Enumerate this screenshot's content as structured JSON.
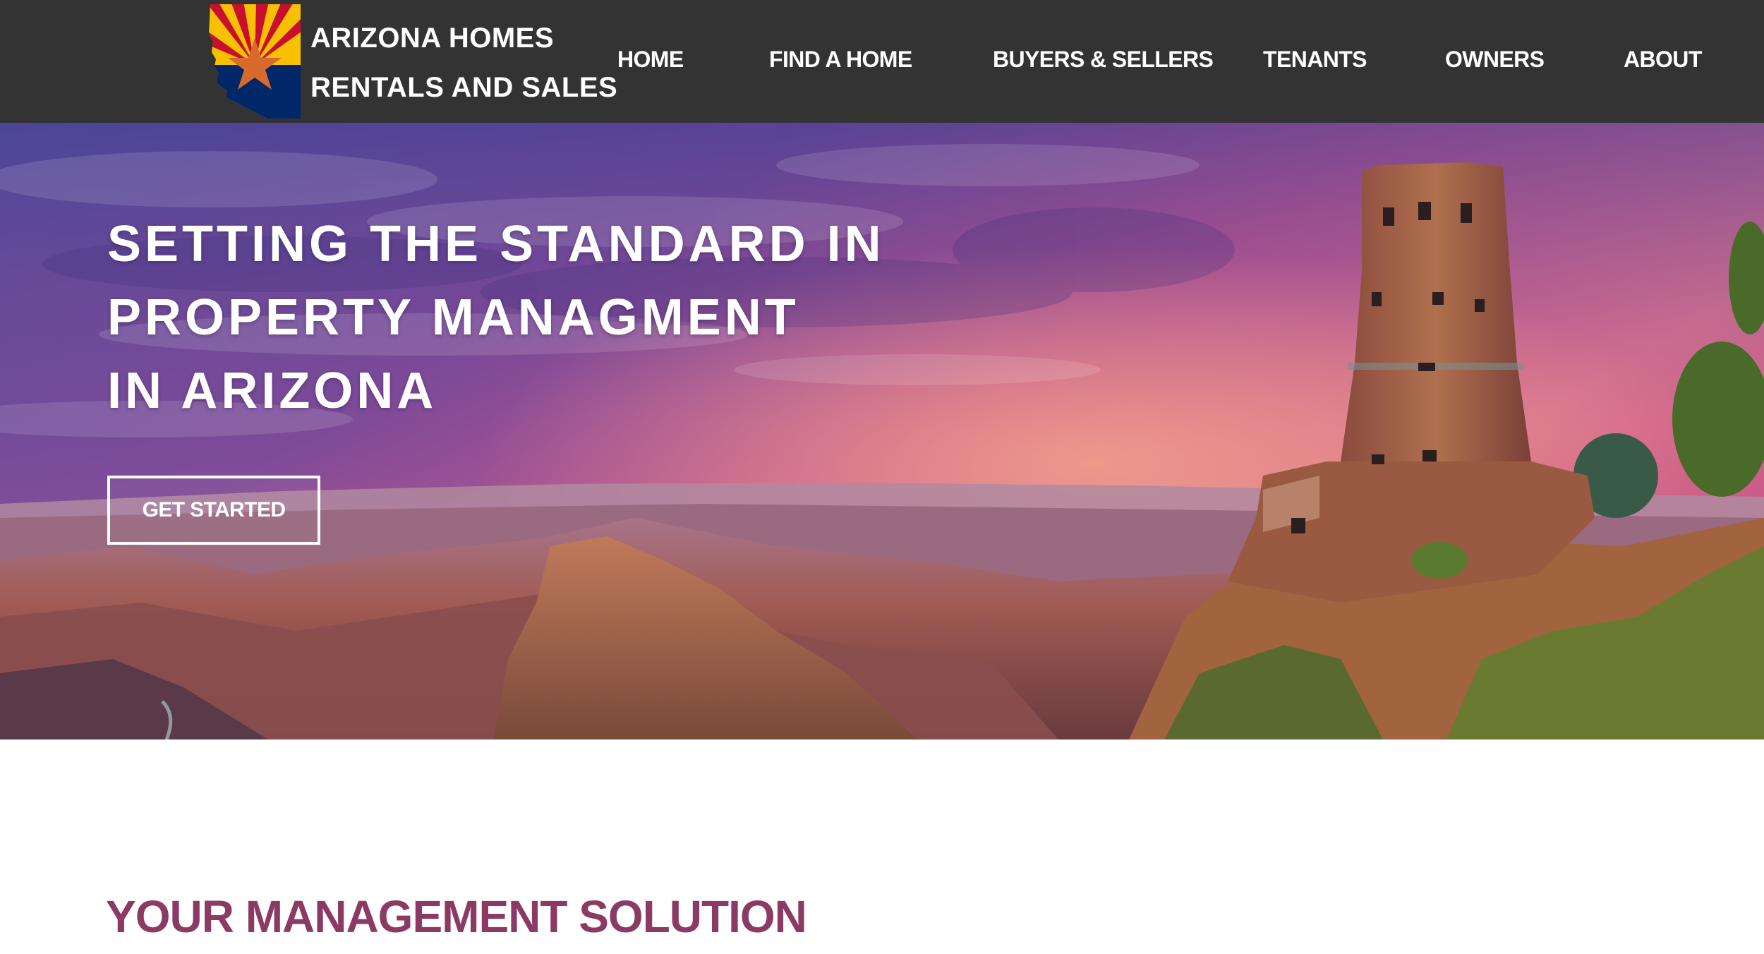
{
  "header": {
    "brand": {
      "line1": "ARIZONA HOMES",
      "line2": "RENTALS AND SALES"
    },
    "nav": [
      {
        "label": "HOME"
      },
      {
        "label": "FIND A HOME"
      },
      {
        "label": "BUYERS & SELLERS"
      },
      {
        "label": "TENANTS"
      },
      {
        "label": "OWNERS"
      },
      {
        "label": "ABOUT"
      }
    ]
  },
  "hero": {
    "title_lines": [
      "SETTING THE STANDARD IN",
      "PROPERTY MANAGMENT",
      "IN ARIZONA"
    ],
    "cta_label": "GET STARTED"
  },
  "section": {
    "title": "YOUR MANAGEMENT SOLUTION"
  },
  "colors": {
    "header_bg": "#333333",
    "section_title": "#8b3a64",
    "flag_red": "#c8102e",
    "flag_yellow": "#f7c000",
    "flag_blue": "#002868",
    "flag_copper": "#d86a2e"
  }
}
